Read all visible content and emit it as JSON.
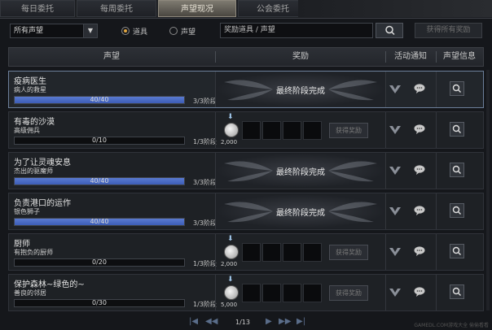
{
  "tabs": [
    {
      "label": "每日委托",
      "active": false
    },
    {
      "label": "每周委托",
      "active": false
    },
    {
      "label": "声望现况",
      "active": true
    },
    {
      "label": "公会委托",
      "active": false
    }
  ],
  "filters": {
    "select_value": "所有声望",
    "radio_items_label": "道具",
    "radio_reputation_label": "声望",
    "selected_radio": "道具",
    "search_placeholder": "奖励道具 / 声望",
    "claim_all_label": "获得所有奖励"
  },
  "columns": {
    "reputation": "声望",
    "reward": "奖励",
    "notify": "活动通知",
    "info": "声望信息"
  },
  "rows": [
    {
      "name": "疫病医生",
      "subtitle": "病人的救星",
      "progress_text": "40/40",
      "progress": 1.0,
      "stage": "3/3阶段",
      "completed": true,
      "reward_done_text": "最终阶段完成"
    },
    {
      "name": "有毒的沙漠",
      "subtitle": "高级佣兵",
      "progress_text": "0/10",
      "progress": 0.0,
      "stage": "1/3阶段",
      "completed": false,
      "coin_amount": "2,000",
      "claim_label": "获得奖励"
    },
    {
      "name": "为了让灵魂安息",
      "subtitle": "杰出的驱魔师",
      "progress_text": "40/40",
      "progress": 1.0,
      "stage": "3/3阶段",
      "completed": true,
      "reward_done_text": "最终阶段完成"
    },
    {
      "name": "负责港口的运作",
      "subtitle": "银色狮子",
      "progress_text": "40/40",
      "progress": 1.0,
      "stage": "3/3阶段",
      "completed": true,
      "reward_done_text": "最终阶段完成"
    },
    {
      "name": "厨师",
      "subtitle": "有抱负的厨师",
      "progress_text": "0/20",
      "progress": 0.0,
      "stage": "1/3阶段",
      "completed": false,
      "coin_amount": "2,000",
      "claim_label": "获得奖励"
    },
    {
      "name": "保护森林~绿色的~",
      "subtitle": "善良的邻居",
      "progress_text": "0/30",
      "progress": 0.0,
      "stage": "1/3阶段",
      "completed": false,
      "coin_amount": "5,000",
      "claim_label": "获得奖励"
    }
  ],
  "pager": {
    "page_text": "1/13"
  },
  "watermark": "GAMEDL.COM游戏大全 偷偷看看",
  "colors": {
    "accent": "#e0a640",
    "progress": "#4a6cc6",
    "selected_border": "#6c7f9a"
  }
}
